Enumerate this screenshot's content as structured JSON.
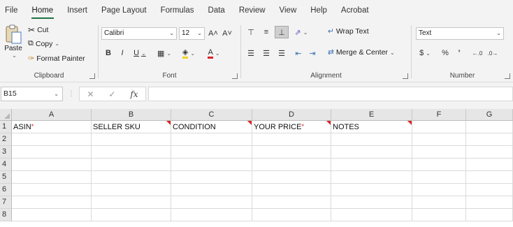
{
  "tabs": [
    "File",
    "Home",
    "Insert",
    "Page Layout",
    "Formulas",
    "Data",
    "Review",
    "View",
    "Help",
    "Acrobat"
  ],
  "active_tab": "Home",
  "clipboard": {
    "paste_label": "Paste",
    "cut_label": "Cut",
    "copy_label": "Copy",
    "format_painter_label": "Format Painter",
    "group_label": "Clipboard"
  },
  "font": {
    "font_name": "Calibri",
    "font_size": "12",
    "bold": "B",
    "italic": "I",
    "underline": "U",
    "grow": "A˄",
    "shrink": "A˅",
    "group_label": "Font"
  },
  "alignment": {
    "wrap_text_label": "Wrap Text",
    "merge_center_label": "Merge & Center",
    "group_label": "Alignment"
  },
  "number": {
    "format_value": "Text",
    "currency": "$",
    "percent": "%",
    "comma": "’",
    "group_label": "Number"
  },
  "formula_bar": {
    "name_box": "B15",
    "fx": "fx",
    "cancel": "✕",
    "enter": "✓",
    "value": ""
  },
  "columns": [
    "A",
    "B",
    "C",
    "D",
    "E",
    "F",
    "G"
  ],
  "rows": [
    "1",
    "2",
    "3",
    "4",
    "5",
    "6",
    "7",
    "8"
  ],
  "row1": {
    "A": "ASIN",
    "B": "SELLER SKU",
    "C": "CONDITION",
    "D": "YOUR PRICE",
    "E": "NOTES"
  },
  "required_marker": "*",
  "colors": {
    "accent": "#217346",
    "required": "#dd2222"
  }
}
